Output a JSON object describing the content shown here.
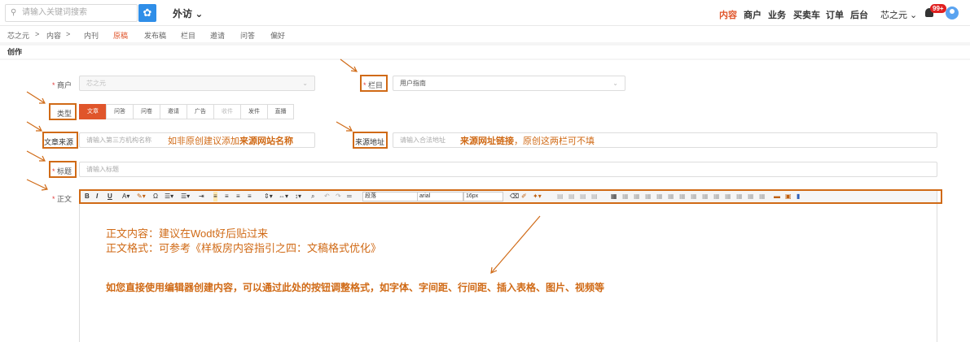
{
  "header": {
    "search_placeholder": "请输入关键词搜索",
    "module": "外访",
    "nav": [
      "内容",
      "商户",
      "业务",
      "买卖车",
      "订单",
      "后台"
    ],
    "user": "芯之元",
    "badge": "99+"
  },
  "breadcrumb": [
    "芯之元",
    ">",
    "内容",
    ">",
    "内刊",
    "原稿",
    "发布稿",
    "栏目",
    "邀请",
    "问答",
    "偏好"
  ],
  "section_title": "创作",
  "form": {
    "merchant_label": "商户",
    "merchant_value": "芯之元",
    "column_label": "栏目",
    "column_value": "用户指南",
    "type_label": "类型",
    "types": [
      "文章",
      "问答",
      "问卷",
      "邀请",
      "广告",
      "收件",
      "发件",
      "直播"
    ],
    "source_label": "文章来源",
    "source_placeholder": "请输入第三方机构名称",
    "source_url_label": "来源地址",
    "source_url_placeholder": "请输入合法地址",
    "title_label": "标题",
    "title_placeholder": "请输入标题",
    "body_label": "正文"
  },
  "toolbar": {
    "paragraph": "段落",
    "font": "arial",
    "size": "16px"
  },
  "annotations": {
    "source_note_pre": "如非原创建议添加",
    "source_note_bold": "来源网站名称",
    "url_note_bold": "来源网址链接",
    "url_note_rest": "，原创这两栏可不填",
    "body_line1": "正文内容：建议在Wodt好后贴过来",
    "body_line2": "正文格式：可参考《样板房内容指引之四：文稿格式优化》",
    "toolbar_note": "如您直接使用编辑器创建内容，可以通过此处的按钮调整格式，如字体、字间距、行间距、插入表格、图片、视频等"
  },
  "colors": {
    "accent": "#e0552b",
    "annotation": "#d06a16",
    "primary": "#2f8ee8"
  }
}
